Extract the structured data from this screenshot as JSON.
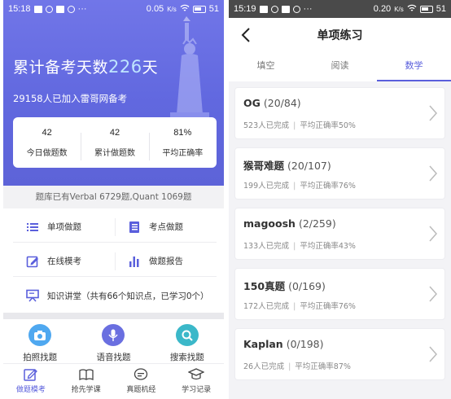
{
  "left": {
    "status": {
      "time": "15:18",
      "speed": "0.05",
      "battery": "51"
    },
    "hero": {
      "title_prefix": "累计备考天数",
      "days": "226",
      "title_suffix": "天",
      "subtitle": "29158人已加入雷哥网备考"
    },
    "stats": [
      {
        "value": "42",
        "label": "今日做题数"
      },
      {
        "value": "42",
        "label": "累计做题数"
      },
      {
        "value": "81%",
        "label": "平均正确率"
      }
    ],
    "bank_info": "题库已有Verbal 6729题,Quant 1069题",
    "menu": {
      "single": "单项做题",
      "point": "考点做题",
      "mock": "在线模考",
      "report": "做题报告",
      "lecture": "知识讲堂（共有66个知识点，已学习0个）"
    },
    "tools": [
      {
        "label": "拍照找题",
        "icon": "camera-icon",
        "color": "#4fa8f0"
      },
      {
        "label": "语音找题",
        "icon": "microphone-icon",
        "color": "#6a6fe0"
      },
      {
        "label": "搜索找题",
        "icon": "search-icon",
        "color": "#3bb8c9"
      }
    ],
    "tabbar": [
      {
        "label": "做题模考",
        "icon": "edit-icon",
        "active": true
      },
      {
        "label": "抢先学课",
        "icon": "book-icon",
        "active": false
      },
      {
        "label": "真题机经",
        "icon": "chat-icon",
        "active": false
      },
      {
        "label": "学习记录",
        "icon": "graduation-cap-icon",
        "active": false
      }
    ],
    "colors": {
      "hero": "#6168df",
      "accent": "#5a5fdc"
    }
  },
  "right": {
    "status": {
      "time": "15:19",
      "speed": "0.20",
      "battery": "51"
    },
    "title": "单项练习",
    "tabs": [
      {
        "label": "填空",
        "active": false
      },
      {
        "label": "阅读",
        "active": false
      },
      {
        "label": "数学",
        "active": true
      }
    ],
    "items": [
      {
        "name": "OG",
        "count": "(20/84)",
        "done": "523人已完成",
        "rate": "平均正确率50%"
      },
      {
        "name": "猴哥难题",
        "count": "(20/107)",
        "done": "199人已完成",
        "rate": "平均正确率76%"
      },
      {
        "name": "magoosh",
        "count": "(2/259)",
        "done": "133人已完成",
        "rate": "平均正确率43%"
      },
      {
        "name": "150真题",
        "count": "(0/169)",
        "done": "172人已完成",
        "rate": "平均正确率76%"
      },
      {
        "name": "Kaplan",
        "count": "(0/198)",
        "done": "26人已完成",
        "rate": "平均正确率87%"
      }
    ]
  }
}
